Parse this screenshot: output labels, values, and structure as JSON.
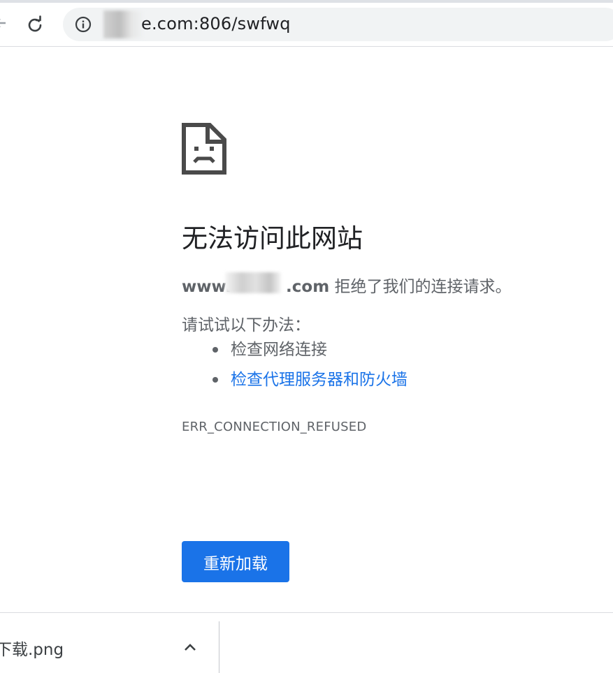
{
  "browser": {
    "url_display": "e.com:806/swfwq"
  },
  "error_page": {
    "title": "无法访问此网站",
    "host": "www.",
    "host_suffix": ".com",
    "message_suffix": " 拒绝了我们的连接请求。",
    "suggestions_heading": "请试试以下办法：",
    "suggestions": [
      {
        "label": "检查网络连接",
        "link": false
      },
      {
        "label": "检查代理服务器和防火墙",
        "link": true
      }
    ],
    "error_code": "ERR_CONNECTION_REFUSED",
    "reload_button_label": "重新加载",
    "accent_color": "#1a73e8"
  },
  "download_bar": {
    "file_name": "下载.png"
  }
}
